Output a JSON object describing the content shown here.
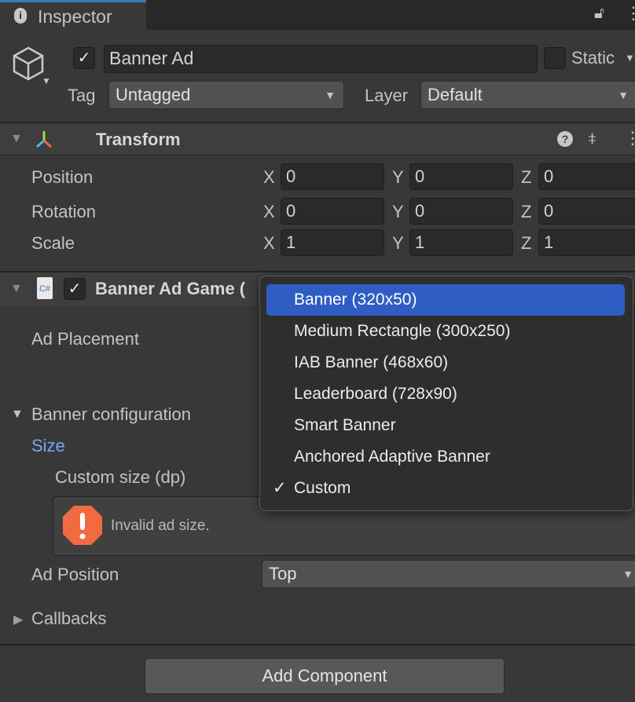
{
  "tab": {
    "title": "Inspector"
  },
  "object": {
    "name": "Banner Ad",
    "active": true,
    "static_label": "Static",
    "static": false,
    "tag_label": "Tag",
    "tag": "Untagged",
    "layer_label": "Layer",
    "layer": "Default"
  },
  "transform": {
    "title": "Transform",
    "rows": [
      {
        "label": "Position",
        "x": "0",
        "y": "0",
        "z": "0"
      },
      {
        "label": "Rotation",
        "x": "0",
        "y": "0",
        "z": "0"
      },
      {
        "label": "Scale",
        "x": "1",
        "y": "1",
        "z": "1"
      }
    ],
    "axes": [
      "X",
      "Y",
      "Z"
    ]
  },
  "component": {
    "title": "Banner Ad Game (",
    "enabled": true,
    "ad_placement": "Ad Placement",
    "banner_config": "Banner configuration",
    "size": "Size",
    "custom_size": "Custom size (dp)",
    "warning": "Invalid ad size.",
    "ad_position_label": "Ad Position",
    "ad_position": "Top",
    "callbacks": "Callbacks"
  },
  "menu": {
    "items": [
      "Banner (320x50)",
      "Medium Rectangle (300x250)",
      "IAB Banner (468x60)",
      "Leaderboard (728x90)",
      "Smart Banner",
      "Anchored Adaptive Banner",
      "Custom"
    ],
    "highlighted": "Banner (320x50)",
    "checked": "Custom"
  },
  "footer": {
    "add_component": "Add Component"
  },
  "colors": {
    "highlight": "#2f5dc4",
    "warning": "#f26a3f",
    "link": "#7ba6f0"
  }
}
